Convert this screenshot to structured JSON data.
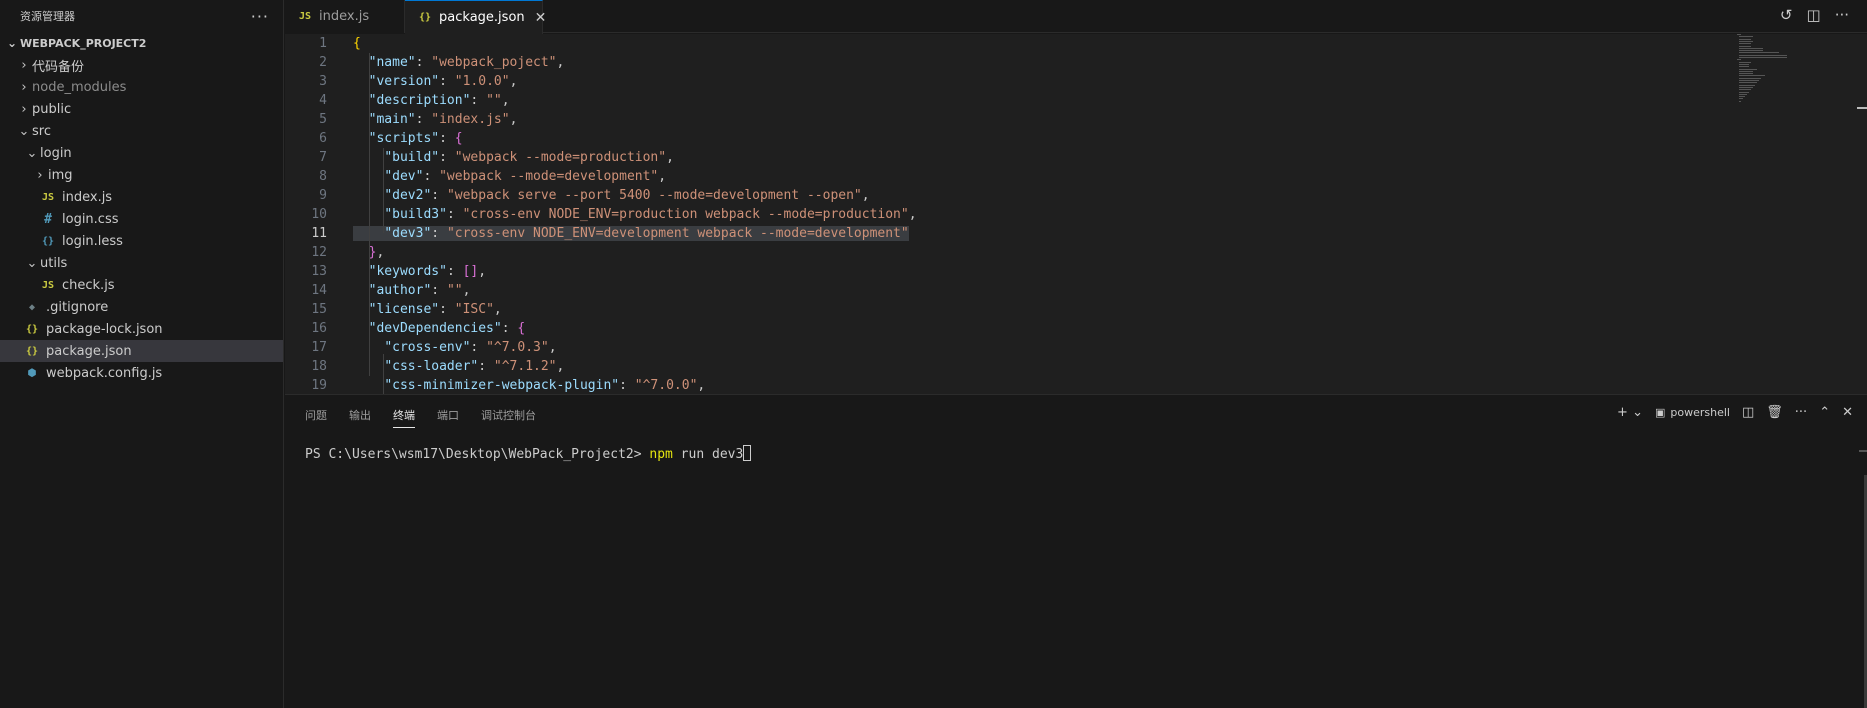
{
  "sidebar": {
    "title": "资源管理器",
    "more": "···",
    "project": "WEBPACK_PROJECT2",
    "items": [
      {
        "label": "代码备份",
        "chev": "›",
        "icon": ""
      },
      {
        "label": "node_modules",
        "chev": "›",
        "icon": ""
      },
      {
        "label": "public",
        "chev": "›",
        "icon": ""
      },
      {
        "label": "src",
        "chev": "⌄",
        "icon": ""
      },
      {
        "label": "login",
        "chev": "⌄",
        "icon": ""
      },
      {
        "label": "img",
        "chev": "›",
        "icon": ""
      },
      {
        "label": "index.js",
        "chev": "",
        "icon": "JS"
      },
      {
        "label": "login.css",
        "chev": "",
        "icon": "#"
      },
      {
        "label": "login.less",
        "chev": "",
        "icon": "{}"
      },
      {
        "label": "utils",
        "chev": "⌄",
        "icon": ""
      },
      {
        "label": "check.js",
        "chev": "",
        "icon": "JS"
      },
      {
        "label": ".gitignore",
        "chev": "",
        "icon": "◆"
      },
      {
        "label": "package-lock.json",
        "chev": "",
        "icon": "{}"
      },
      {
        "label": "package.json",
        "chev": "",
        "icon": "{}"
      },
      {
        "label": "webpack.config.js",
        "chev": "",
        "icon": "⬢"
      }
    ]
  },
  "tabs": [
    {
      "label": "index.js",
      "icon": "JS"
    },
    {
      "label": "package.json",
      "icon": "{}",
      "close": "✕"
    }
  ],
  "editor": {
    "line_numbers": [
      "1",
      "2",
      "3",
      "4",
      "5",
      "6",
      "7",
      "8",
      "9",
      "10",
      "11",
      "12",
      "13",
      "14",
      "15",
      "16",
      "17",
      "18",
      "19"
    ],
    "current_line": 11
  },
  "panel": {
    "tabs": [
      "问题",
      "输出",
      "终端",
      "端口",
      "调试控制台"
    ],
    "active_tab": "终端",
    "shell": "powershell",
    "prompt": "PS C:\\Users\\wsm17\\Desktop\\WebPack_Project2> ",
    "command": "npm",
    "args": " run dev3"
  },
  "colors": {
    "accent": "#0078d4",
    "key": "#9cdcfe",
    "string": "#ce9178"
  }
}
